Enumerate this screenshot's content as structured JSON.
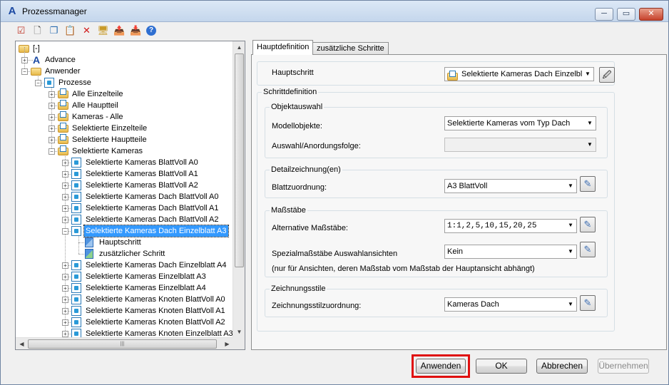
{
  "window": {
    "title": "Prozessmanager",
    "logo": "A",
    "controls": {
      "minimize": "─",
      "maximize": "▭",
      "close": "✕"
    }
  },
  "toolbar": {
    "buttons": [
      {
        "name": "properties-icon",
        "glyph": "☑"
      },
      {
        "name": "new-icon",
        "glyph": "🗋"
      },
      {
        "name": "copy-icon",
        "glyph": "❐"
      },
      {
        "name": "paste-icon",
        "glyph": "📋"
      },
      {
        "name": "delete-icon",
        "glyph": "✕"
      },
      {
        "name": "monitor-icon",
        "glyph": "🖥"
      },
      {
        "name": "export-icon",
        "glyph": "📤"
      },
      {
        "name": "import-icon",
        "glyph": "📥"
      },
      {
        "name": "help-icon",
        "glyph": "?"
      }
    ]
  },
  "tree": {
    "root_label": "[-]",
    "items": [
      {
        "label": "Advance",
        "level": 1,
        "icon": "advance",
        "expander": "+"
      },
      {
        "label": "Anwender",
        "level": 1,
        "icon": "folder",
        "expander": "−"
      },
      {
        "label": "Prozesse",
        "level": 2,
        "icon": "process",
        "expander": "−"
      },
      {
        "label": "Alle Einzelteile",
        "level": 3,
        "icon": "folderprocess",
        "expander": "+"
      },
      {
        "label": "Alle Hauptteil",
        "level": 3,
        "icon": "folderprocess",
        "expander": "+"
      },
      {
        "label": "Kameras - Alle",
        "level": 3,
        "icon": "folderprocess",
        "expander": "+"
      },
      {
        "label": "Selektierte Einzelteile",
        "level": 3,
        "icon": "folderprocess",
        "expander": "+"
      },
      {
        "label": "Selektierte Hauptteile",
        "level": 3,
        "icon": "folderprocess",
        "expander": "+"
      },
      {
        "label": "Selektierte Kameras",
        "level": 3,
        "icon": "folderprocess",
        "expander": "−"
      },
      {
        "label": "Selektierte Kameras BlattVoll A0",
        "level": 4,
        "icon": "process",
        "expander": "+"
      },
      {
        "label": "Selektierte Kameras BlattVoll A1",
        "level": 4,
        "icon": "process",
        "expander": "+"
      },
      {
        "label": "Selektierte Kameras BlattVoll A2",
        "level": 4,
        "icon": "process",
        "expander": "+"
      },
      {
        "label": "Selektierte Kameras Dach BlattVoll A0",
        "level": 4,
        "icon": "process",
        "expander": "+"
      },
      {
        "label": "Selektierte Kameras Dach BlattVoll A1",
        "level": 4,
        "icon": "process",
        "expander": "+"
      },
      {
        "label": "Selektierte Kameras Dach BlattVoll A2",
        "level": 4,
        "icon": "process",
        "expander": "+"
      },
      {
        "label": "Selektierte Kameras Dach Einzelblatt A3",
        "level": 4,
        "icon": "process",
        "expander": "−",
        "selected": true
      },
      {
        "label": "Hauptschritt",
        "level": 5,
        "icon": "step",
        "expander": ""
      },
      {
        "label": "zusätzlicher Schritt",
        "level": 5,
        "icon": "step2",
        "expander": ""
      },
      {
        "label": "Selektierte Kameras Dach Einzelblatt A4",
        "level": 4,
        "icon": "process",
        "expander": "+"
      },
      {
        "label": "Selektierte Kameras Einzelblatt A3",
        "level": 4,
        "icon": "process",
        "expander": "+"
      },
      {
        "label": "Selektierte Kameras Einzelblatt A4",
        "level": 4,
        "icon": "process",
        "expander": "+"
      },
      {
        "label": "Selektierte Kameras Knoten BlattVoll A0",
        "level": 4,
        "icon": "process",
        "expander": "+"
      },
      {
        "label": "Selektierte Kameras Knoten BlattVoll A1",
        "level": 4,
        "icon": "process",
        "expander": "+"
      },
      {
        "label": "Selektierte Kameras Knoten BlattVoll A2",
        "level": 4,
        "icon": "process",
        "expander": "+"
      },
      {
        "label": "Selektierte Kameras Knoten Einzelblatt A3",
        "level": 4,
        "icon": "process",
        "expander": "+"
      }
    ]
  },
  "tabs": [
    {
      "label": "Hauptdefinition",
      "active": true
    },
    {
      "label": "zusätzliche Schritte",
      "active": false
    }
  ],
  "main": {
    "hauptschritt_label": "Hauptschritt",
    "hauptschritt_value": "Selektierte Kameras Dach Einzelbla",
    "schrittdefinition_title": "Schrittdefinition",
    "objektauswahl": {
      "title": "Objektauswahl",
      "modellobjekte_label": "Modellobjekte:",
      "modellobjekte_value": "Selektierte Kameras vom Typ Dach",
      "auswahl_label": "Auswahl/Anordungsfolge:",
      "auswahl_value": ""
    },
    "detailzeichnung": {
      "title": "Detailzeichnung(en)",
      "blatt_label": "Blattzuordnung:",
      "blatt_value": "A3 BlattVoll"
    },
    "massstaebe": {
      "title": "Maßstäbe",
      "alt_label": "Alternative Maßstäbe:",
      "alt_value": "1:1,2,5,10,15,20,25",
      "spezial_label": "Spezialmaßstäbe Auswahlansichten",
      "spezial_value": "Kein",
      "note": "(nur für Ansichten, deren Maßstab vom Maßstab der Hauptansicht abhängt)"
    },
    "zeichnungsstile": {
      "title": "Zeichnungsstile",
      "zuordnung_label": "Zeichnungsstilzuordnung:",
      "zuordnung_value": "Kameras Dach"
    }
  },
  "buttons": {
    "apply": "Anwenden",
    "ok": "OK",
    "cancel": "Abbrechen",
    "accept": "Übernehmen"
  },
  "colors": {
    "selection": "#3399ff",
    "highlight_frame": "#e01010",
    "titlebar": "#c4d6ec"
  }
}
